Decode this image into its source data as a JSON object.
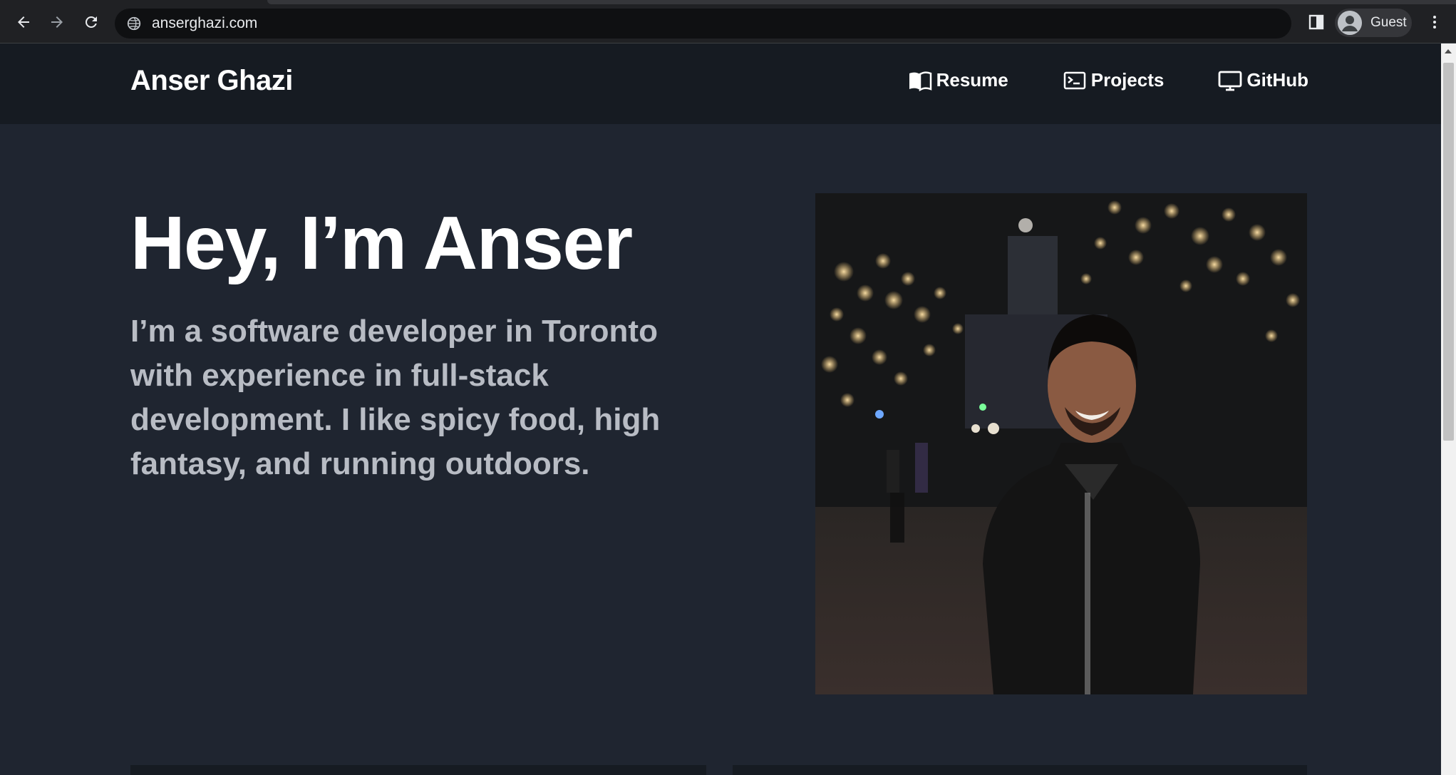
{
  "browser": {
    "url": "anserghazi.com",
    "profile_label": "Guest"
  },
  "header": {
    "brand": "Anser Ghazi",
    "nav": [
      {
        "label": "Resume",
        "icon": "book-icon"
      },
      {
        "label": "Projects",
        "icon": "terminal-icon"
      },
      {
        "label": "GitHub",
        "icon": "monitor-icon"
      }
    ]
  },
  "hero": {
    "title": "Hey, I’m Anser",
    "bio": "I’m a software developer in Toronto with experience in full-stack development. I like spicy food, high fantasy, and running outdoors."
  },
  "colors": {
    "page_bg": "#1f2530",
    "header_bg": "#161b22",
    "text_primary": "#ffffff",
    "text_secondary": "#b8bcc4"
  }
}
